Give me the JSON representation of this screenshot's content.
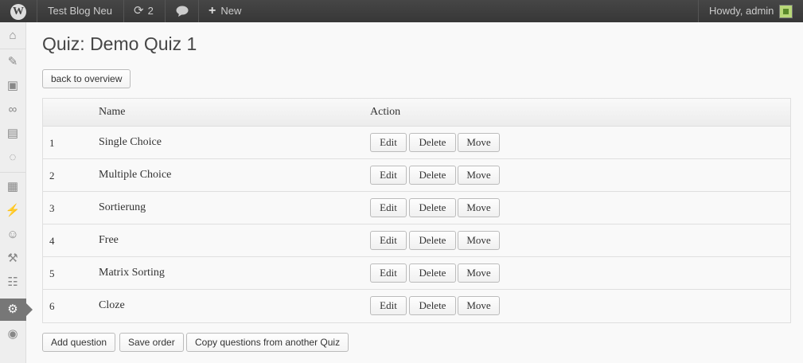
{
  "admin_bar": {
    "site_name": "Test Blog Neu",
    "updates_count": "2",
    "new_label": "New",
    "greeting": "Howdy, admin"
  },
  "page": {
    "title": "Quiz: Demo Quiz 1",
    "back_button": "back to overview"
  },
  "table": {
    "headers": {
      "name": "Name",
      "action": "Action"
    },
    "rows": [
      {
        "num": "1",
        "name": "Single Choice"
      },
      {
        "num": "2",
        "name": "Multiple Choice"
      },
      {
        "num": "3",
        "name": "Sortierung"
      },
      {
        "num": "4",
        "name": "Free"
      },
      {
        "num": "5",
        "name": "Matrix Sorting"
      },
      {
        "num": "6",
        "name": "Cloze"
      }
    ],
    "row_actions": {
      "edit": "Edit",
      "delete": "Delete",
      "move": "Move"
    }
  },
  "footer_buttons": {
    "add_question": "Add question",
    "save_order": "Save order",
    "copy_questions": "Copy questions from another Quiz"
  },
  "sidebar": {
    "items": [
      "dashboard-icon",
      "posts-icon",
      "media-icon",
      "links-icon",
      "pages-icon",
      "comments-icon",
      "appearance-icon",
      "plugins-icon",
      "users-icon",
      "tools-icon",
      "settings-panel-icon",
      "settings-gear-icon",
      "collapse-icon"
    ],
    "active": "settings-gear-icon"
  },
  "colors": {
    "admin_bar": "#464646",
    "active_menu": "#777777",
    "background": "#f9f9f9"
  }
}
